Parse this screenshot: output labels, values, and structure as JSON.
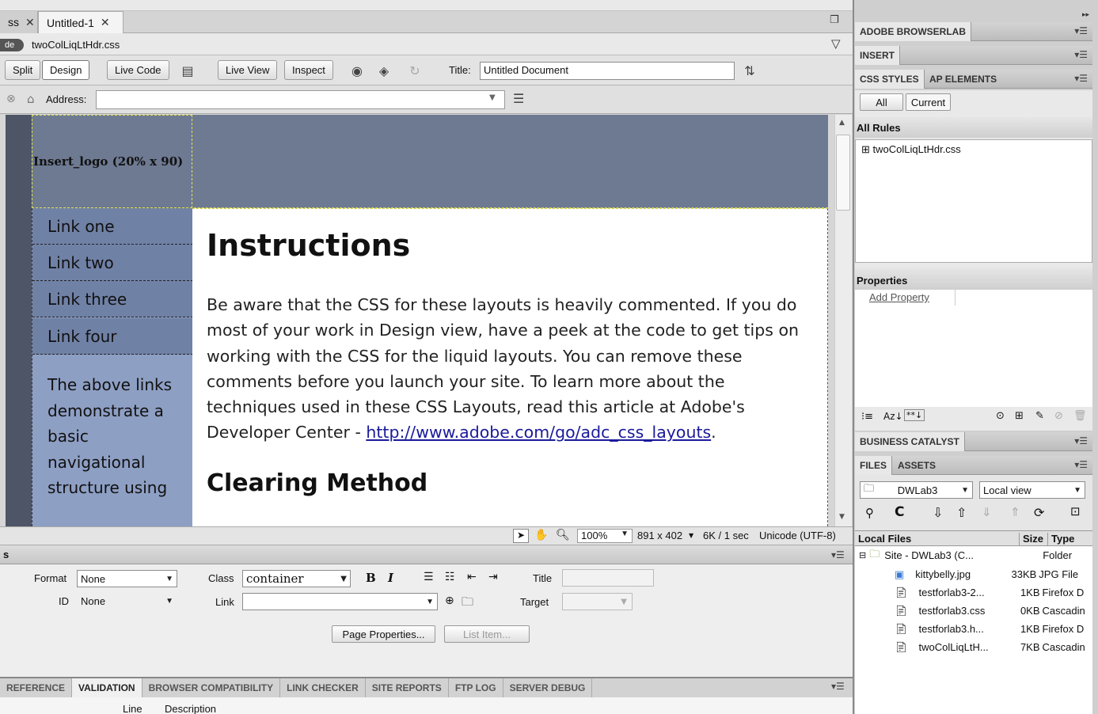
{
  "document_tabs": [
    {
      "label": "ss"
    },
    {
      "label": "Untitled-1"
    }
  ],
  "related_files": {
    "source_label": "de",
    "file": "twoColLiqLtHdr.css"
  },
  "doc_toolbar": {
    "split": "Split",
    "design": "Design",
    "live_code": "Live Code",
    "live_view": "Live View",
    "inspect": "Inspect",
    "title_label": "Title:",
    "title_value": "Untitled Document"
  },
  "address": {
    "label": "Address:",
    "value": ""
  },
  "page": {
    "logo": "Insert_logo (20% x 90)",
    "nav_links": [
      "Link one",
      "Link two",
      "Link three",
      "Link four"
    ],
    "sidebar_text": "The above links demonstrate a basic navigational structure using",
    "heading": "Instructions",
    "paragraph": "Be aware that the CSS for these layouts is heavily commented. If you do most of your work in Design view, have a peek at the code to get tips on working with the CSS for the liquid layouts. You can remove these comments before you launch your site. To learn more about the techniques used in these CSS Layouts, read this article at Adobe's Developer Center - ",
    "link": "http://www.adobe.com/go/adc_css_layouts",
    "paragraph_end": ".",
    "heading2": "Clearing Method"
  },
  "status": {
    "zoom": "100%",
    "dimensions": "891 x 402",
    "size_time": "6K / 1 sec",
    "encoding": "Unicode (UTF-8)"
  },
  "properties": {
    "panel_label": "s",
    "format_label": "Format",
    "format_value": "None",
    "id_label": "ID",
    "id_value": "None",
    "class_label": "Class",
    "class_value": "container",
    "link_label": "Link",
    "link_value": "",
    "title_label": "Title",
    "target_label": "Target",
    "page_properties": "Page Properties...",
    "list_item": "List Item..."
  },
  "results_tabs": [
    "REFERENCE",
    "VALIDATION",
    "BROWSER COMPATIBILITY",
    "LINK CHECKER",
    "SITE REPORTS",
    "FTP LOG",
    "SERVER DEBUG"
  ],
  "results_columns": {
    "line": "Line",
    "description": "Description"
  },
  "right_panels": {
    "browserlab": "ADOBE BROWSERLAB",
    "insert": "INSERT",
    "css_styles": "CSS STYLES",
    "ap_elements": "AP ELEMENTS",
    "all": "All",
    "current": "Current",
    "all_rules": "All Rules",
    "rule_file": "twoColLiqLtHdr.css",
    "properties": "Properties",
    "add_property": "Add Property",
    "business_catalyst": "BUSINESS CATALYST",
    "files": "FILES",
    "assets": "ASSETS",
    "site_select": "DWLab3",
    "view_select": "Local view",
    "local_files": "Local Files",
    "size": "Size",
    "type": "Type"
  },
  "files": [
    {
      "name": "Site - DWLab3 (C...",
      "size": "",
      "type": "Folder"
    },
    {
      "name": "kittybelly.jpg",
      "size": "33KB",
      "type": "JPG File"
    },
    {
      "name": "testforlab3-2...",
      "size": "1KB",
      "type": "Firefox D"
    },
    {
      "name": "testforlab3.css",
      "size": "0KB",
      "type": "Cascadin"
    },
    {
      "name": "testforlab3.h...",
      "size": "1KB",
      "type": "Firefox D"
    },
    {
      "name": "twoColLiqLtH...",
      "size": "7KB",
      "type": "Cascadin"
    }
  ]
}
